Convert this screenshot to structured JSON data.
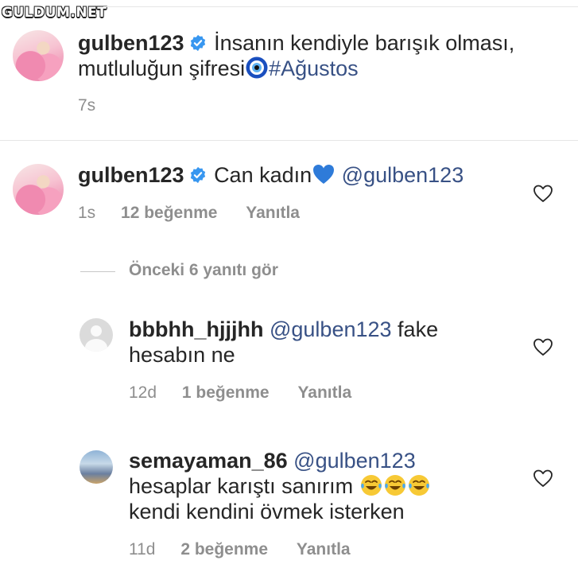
{
  "watermark": "GULDUM.NET",
  "caption": {
    "username": "gulben123",
    "line1": "İnsanın kendiyle barışık olması,",
    "line2_text": "mutluluğun şifresi",
    "hashtag": "#Ağustos",
    "time": "7s",
    "emoji_icon": "nazar-evil-eye-icon"
  },
  "comment1": {
    "username": "gulben123",
    "text": "Can kadın",
    "emoji_icon": "blue-heart-icon",
    "mention": "@gulben123",
    "time": "1s",
    "likes": "12 beğenme",
    "reply": "Yanıtla"
  },
  "view_replies": "Önceki 6 yanıtı gör",
  "reply1": {
    "username": "bbbhh_hjjjhh",
    "mention": "@gulben123",
    "text1": "fake",
    "text2": "hesabın ne",
    "time": "12d",
    "likes": "1 beğenme",
    "reply": "Yanıtla"
  },
  "reply2": {
    "username": "semayaman_86",
    "mention": "@gulben123",
    "text1": "hesaplar karıştı sanırım",
    "text2": "kendi kendini övmek isterken",
    "emoji_icon": "tears-of-joy-icon",
    "time": "11d",
    "likes": "2 beğenme",
    "reply": "Yanıtla"
  },
  "colors": {
    "text": "#262626",
    "muted": "#8e8e8e",
    "link": "#385185",
    "verified": "#3897f0",
    "heart_stroke": "#262626"
  }
}
